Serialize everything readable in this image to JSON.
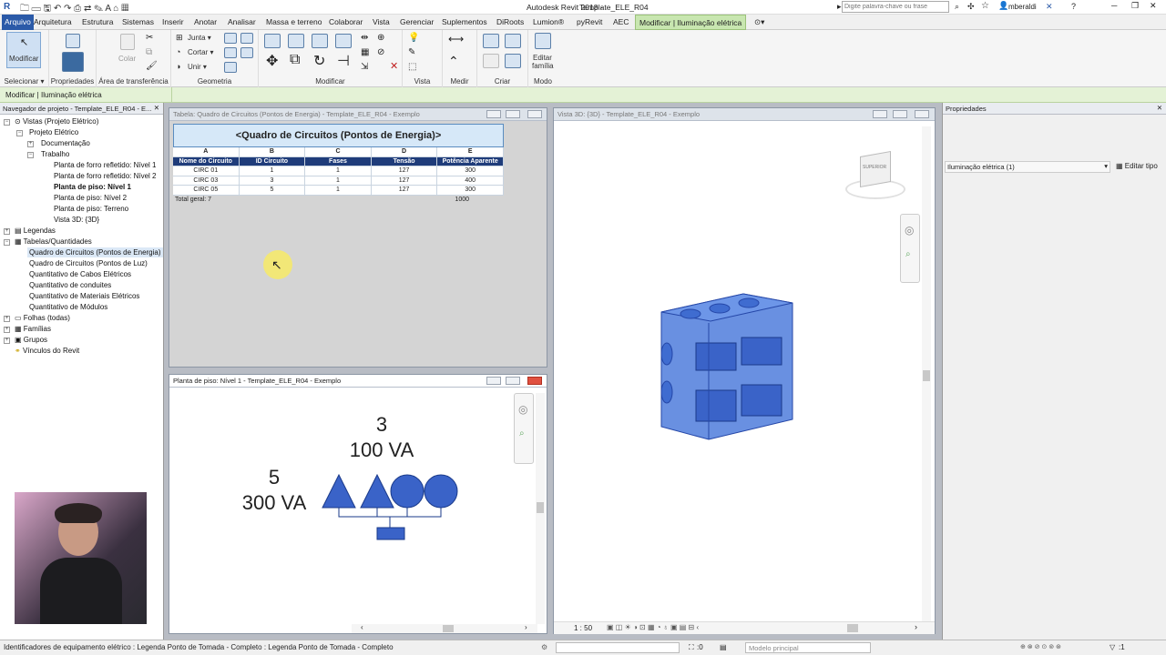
{
  "app": {
    "title": "Autodesk Revit 2018 -",
    "file": "Template_ELE_R04",
    "search_placeholder": "Digite palavra-chave ou frase",
    "user": "mberaldi"
  },
  "menu": {
    "file_tab": "Arquivo",
    "tabs": [
      "Arquitetura",
      "Estrutura",
      "Sistemas",
      "Inserir",
      "Anotar",
      "Analisar",
      "Massa e terreno",
      "Colaborar",
      "Vista",
      "Gerenciar",
      "Suplementos",
      "DiRoots",
      "Lumion®",
      "pyRevit",
      "AEC"
    ],
    "active_tab": "Modificar | Iluminação elétrica"
  },
  "ribbon": {
    "modify_label": "Modificar",
    "select_label": "Selecionar",
    "properties_label": "Propriedades",
    "clipboard_label": "Área de transferência",
    "paste_label": "Colar",
    "geometry_label": "Geometria",
    "join_label": "Junta",
    "cut_label": "Cortar",
    "unite_label": "Unir",
    "modify_group_label": "Modificar",
    "view_label": "Vista",
    "measure_label": "Medir",
    "create_label": "Criar",
    "mode_label": "Modo",
    "edit_family_label": "Editar",
    "edit_family_label2": "família"
  },
  "context_bar": {
    "label": "Modificar | Iluminação elétrica"
  },
  "project_browser": {
    "title": "Navegador de projeto - Template_ELE_R04 - E...",
    "items": [
      "Vistas (Projeto Elétrico)",
      "Projeto Elétrico",
      "Documentação",
      "Trabalho",
      "Planta de forro refletido: Nível 1",
      "Planta de forro refletido: Nível 2",
      "Planta de piso: Nível 1",
      "Planta de piso: Nível 2",
      "Planta de piso: Terreno",
      "Vista 3D: {3D}",
      "Legendas",
      "Tabelas/Quantidades",
      "Quadro de Circuitos (Pontos de Energia)",
      "Quadro de Circuitos (Pontos de Luz)",
      "Quantitativo de Cabos Elétricos",
      "Quantitativo de conduites",
      "Quantitativo de Materiais Elétricos",
      "Quantitativo de Módulos",
      "Folhas (todas)",
      "Famílias",
      "Grupos",
      "Vínculos do Revit"
    ]
  },
  "schedule_window": {
    "title": "Tabela: Quadro de Circuitos (Pontos de Energia) - Template_ELE_R04 - Exemplo",
    "heading": "<Quadro de Circuitos (Pontos de Energia)>",
    "letters": [
      "A",
      "B",
      "C",
      "D",
      "E"
    ],
    "columns": [
      "Nome do Circuito",
      "ID Circuito",
      "Fases",
      "Tensão",
      "Potência Aparente"
    ],
    "rows": [
      [
        "CIRC 01",
        "1",
        "1",
        "127",
        "300"
      ],
      [
        "CIRC 03",
        "3",
        "1",
        "127",
        "400"
      ],
      [
        "CIRC 05",
        "5",
        "1",
        "127",
        "300"
      ]
    ],
    "total_label": "Total geral: 7",
    "total_value": "1000"
  },
  "plan_window": {
    "title": "Planta de piso: Nível 1 - Template_ELE_R04 - Exemplo",
    "tag_top_num": "3",
    "tag_top_power": "100 VA",
    "tag_left_num": "5",
    "tag_left_power": "300 VA"
  },
  "view3d_window": {
    "title": "Vista 3D: {3D} - Template_ELE_R04 - Exemplo",
    "scale": "1 : 50",
    "cube_label": "SUPERIOR"
  },
  "properties": {
    "title": "Propriedades",
    "type_value": "Iluminação elétrica (1)",
    "edit_type": "Editar tipo"
  },
  "status": {
    "text": "Identificadores de equipamento elétrico : Legenda Ponto de Tomada - Completo : Legenda Ponto de Tomada - Completo",
    "count": ":0",
    "model": "Modelo principal",
    "filter": ":1"
  },
  "colors": {
    "accent_green": "#c8e6b0",
    "element_blue": "#3a63c8",
    "schedule_header": "#1f3c7a"
  }
}
